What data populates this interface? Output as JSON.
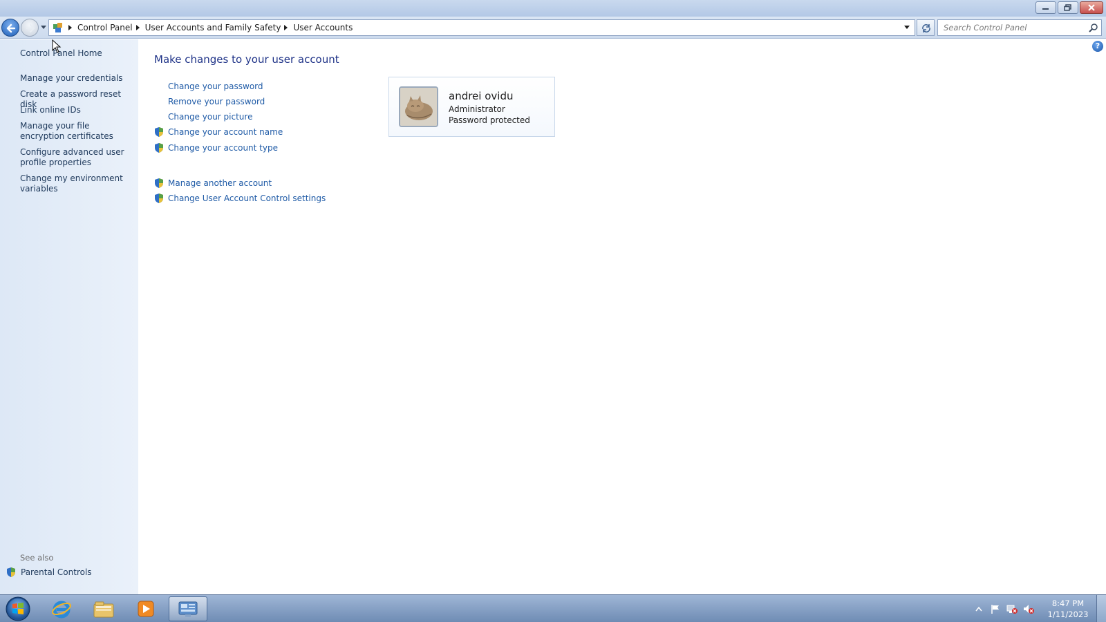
{
  "window": {
    "minimize_icon": "minimize-icon",
    "maximize_icon": "restore-icon",
    "close_icon": "close-icon"
  },
  "address_bar": {
    "breadcrumbs": [
      "Control Panel",
      "User Accounts and Family Safety",
      "User Accounts"
    ]
  },
  "search": {
    "placeholder": "Search Control Panel"
  },
  "sidebar": {
    "home": "Control Panel Home",
    "links": [
      {
        "label": "Manage your credentials"
      },
      {
        "label": "Create a password reset disk"
      },
      {
        "label": "Link online IDs"
      },
      {
        "label": "Manage your file encryption certificates"
      },
      {
        "label": "Configure advanced user profile properties"
      },
      {
        "label": "Change my environment variables"
      }
    ],
    "see_also": "See also",
    "parental_controls": "Parental Controls"
  },
  "main": {
    "heading": "Make changes to your user account",
    "tasks": [
      {
        "label": "Change your password",
        "shield": false
      },
      {
        "label": "Remove your password",
        "shield": false
      },
      {
        "label": "Change your picture",
        "shield": false
      },
      {
        "label": "Change your account name",
        "shield": true
      },
      {
        "label": "Change your account type",
        "shield": true
      }
    ],
    "other_tasks": [
      {
        "label": "Manage another account",
        "shield": true
      },
      {
        "label": "Change User Account Control settings",
        "shield": true
      }
    ]
  },
  "account": {
    "name": "andrei ovidu",
    "role": "Administrator",
    "status": "Password protected"
  },
  "taskbar": {
    "items": [
      "internet-explorer-icon",
      "windows-explorer-icon",
      "media-player-icon",
      "control-panel-icon"
    ],
    "time": "8:47 PM",
    "date": "1/11/2023"
  },
  "colors": {
    "link": "#1e5aa6",
    "heading": "#1e3287",
    "sidebar_bg": "#dde8f6"
  }
}
